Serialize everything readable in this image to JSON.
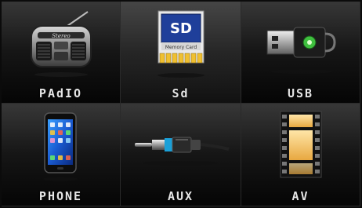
{
  "menu": {
    "tiles": [
      {
        "label": "PAdIO",
        "icon": "radio-icon"
      },
      {
        "label": "Sd",
        "icon": "sd-card-icon",
        "card_text": "SD",
        "card_subtext": "Memory Card"
      },
      {
        "label": "USB",
        "icon": "usb-drive-icon"
      },
      {
        "label": "PHONE",
        "icon": "phone-icon"
      },
      {
        "label": "AUX",
        "icon": "aux-cable-icon"
      },
      {
        "label": "AV",
        "icon": "film-icon"
      }
    ],
    "selected": "Sd"
  },
  "colors": {
    "background": "#0b0b0b",
    "label": "#e6e6e6",
    "sd_blue": "#1f3f9a",
    "usb_green": "#3fbf3f",
    "film_amber": "#f2c069"
  }
}
